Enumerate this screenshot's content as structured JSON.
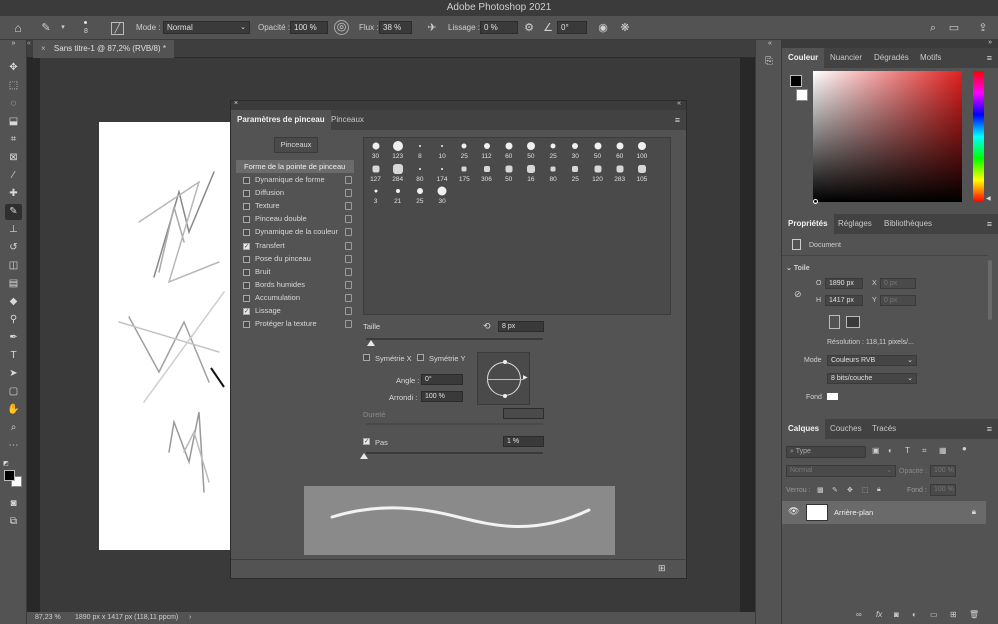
{
  "app": {
    "title": "Adobe Photoshop 2021"
  },
  "options_bar": {
    "brush_size": "8",
    "mode_label": "Mode :",
    "mode_value": "Normal",
    "opacity_label": "Opacité :",
    "opacity_value": "100 %",
    "flow_label": "Flux :",
    "flow_value": "38 %",
    "smoothing_label": "Lissage :",
    "smoothing_value": "0 %",
    "angle_value": "0°"
  },
  "document": {
    "tab_title": "Sans titre-1 @ 87,2% (RVB/8) *",
    "zoom": "87,23 %",
    "info": "1890 px x 1417 px (118,11 ppcm)"
  },
  "brush_dialog": {
    "tab_settings": "Paramètres de pinceau",
    "tab_brushes": "Pinceaux",
    "brushes_button": "Pinceaux",
    "tip_shape_header": "Forme de la pointe de pinceau",
    "options": [
      {
        "label": "Dynamique de forme",
        "checked": false
      },
      {
        "label": "Diffusion",
        "checked": false
      },
      {
        "label": "Texture",
        "checked": false
      },
      {
        "label": "Pinceau double",
        "checked": false
      },
      {
        "label": "Dynamique de la couleur",
        "checked": false
      },
      {
        "label": "Transfert",
        "checked": true
      },
      {
        "label": "Pose du pinceau",
        "checked": false
      },
      {
        "label": "Bruit",
        "checked": false
      },
      {
        "label": "Bords humides",
        "checked": false
      },
      {
        "label": "Accumulation",
        "checked": false
      },
      {
        "label": "Lissage",
        "checked": true
      },
      {
        "label": "Protéger la texture",
        "checked": false
      }
    ],
    "tips": [
      [
        "30",
        "123",
        "8",
        "10",
        "25",
        "112",
        "60",
        "50",
        "25",
        "30",
        "50",
        "60",
        "100"
      ],
      [
        "127",
        "284",
        "80",
        "174",
        "175",
        "306",
        "50",
        "16",
        "80",
        "25",
        "120",
        "283",
        "105"
      ],
      [
        "3",
        "21",
        "25",
        "30"
      ]
    ],
    "size_label": "Taille",
    "size_value": "8 px",
    "flip_x_label": "Symétrie X",
    "flip_y_label": "Symétrie Y",
    "angle_label": "Angle :",
    "angle_value": "0°",
    "roundness_label": "Arrondi :",
    "roundness_value": "100 %",
    "hardness_label": "Dureté",
    "spacing_label": "Pas",
    "spacing_checked": true,
    "spacing_value": "1 %"
  },
  "color_panel": {
    "tabs": [
      "Couleur",
      "Nuancier",
      "Dégradés",
      "Motifs"
    ],
    "hue_color": "#e0201f"
  },
  "properties_panel": {
    "tabs": [
      "Propriétés",
      "Réglages",
      "Bibliothèques"
    ],
    "document_label": "Document",
    "canvas_header": "Toile",
    "width_label": "O",
    "width_value": "1890 px",
    "height_label": "H",
    "height_value": "1417 px",
    "x_label": "X",
    "x_placeholder": "0 px",
    "y_label": "Y",
    "y_placeholder": "0 px",
    "resolution": "Résolution : 118,11 pixels/...",
    "mode_label": "Mode",
    "mode_value": "Couleurs RVB",
    "depth_value": "8 bits/couche",
    "background_label": "Fond"
  },
  "layers_panel": {
    "tabs": [
      "Calques",
      "Couches",
      "Tracés"
    ],
    "filter_placeholder": "Type",
    "blend_mode": "Normal",
    "opacity_label": "Opacité :",
    "opacity_value": "100 %",
    "lock_label": "Verrou :",
    "fill_label": "Fond :",
    "fill_value": "100 %",
    "layer_name": "Arrière-plan"
  }
}
